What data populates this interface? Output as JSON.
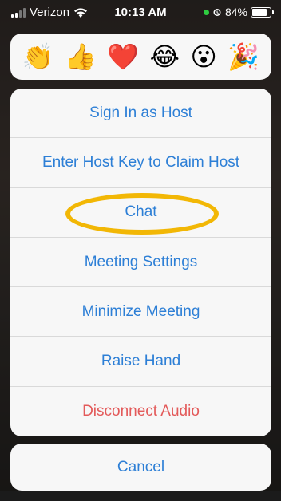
{
  "status_bar": {
    "carrier": "Verizon",
    "time": "10:13 AM",
    "battery_percent": "84%",
    "battery_level": 0.84
  },
  "reactions": [
    {
      "glyph": "👏",
      "name": "clap"
    },
    {
      "glyph": "👍",
      "name": "thumbs-up"
    },
    {
      "glyph": "❤️",
      "name": "heart"
    },
    {
      "glyph": "😂",
      "name": "joy"
    },
    {
      "glyph": "😮",
      "name": "open-mouth"
    },
    {
      "glyph": "🎉",
      "name": "party"
    }
  ],
  "menu": {
    "items": [
      {
        "label": "Sign In as Host"
      },
      {
        "label": "Enter Host Key to Claim Host"
      },
      {
        "label": "Chat"
      },
      {
        "label": "Meeting Settings"
      },
      {
        "label": "Minimize Meeting"
      },
      {
        "label": "Raise Hand"
      },
      {
        "label": "Disconnect Audio"
      }
    ],
    "cancel_label": "Cancel"
  },
  "colors": {
    "link_blue": "#2d7fd6",
    "danger_red": "#e35a5a",
    "highlight": "#f2b705"
  }
}
